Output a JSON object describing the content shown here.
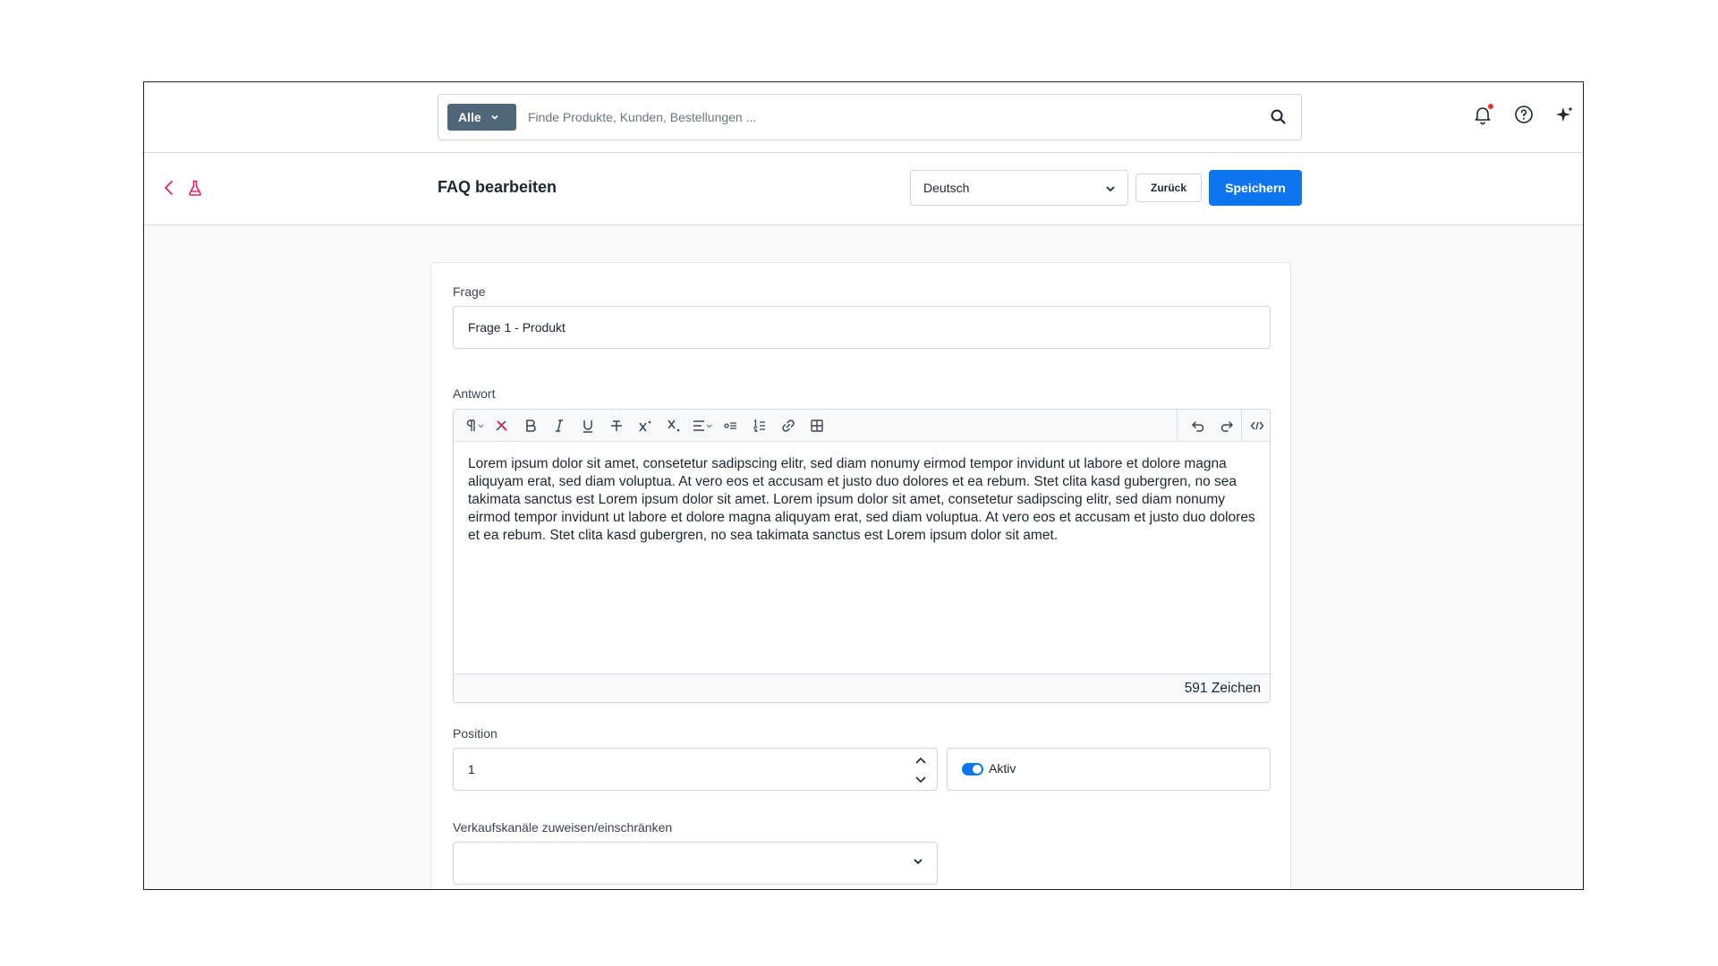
{
  "search": {
    "filter_label": "Alle",
    "placeholder": "Finde Produkte, Kunden, Bestellungen ..."
  },
  "header": {
    "title": "FAQ bearbeiten",
    "language": "Deutsch",
    "back_label": "Zurück",
    "save_label": "Speichern"
  },
  "form": {
    "question_label": "Frage",
    "question_value": "Frage 1 - Produkt",
    "answer_label": "Antwort",
    "answer_text": "Lorem ipsum dolor sit amet, consetetur sadipscing elitr, sed diam nonumy eirmod tempor invidunt ut labore et dolore magna aliquyam erat, sed diam voluptua. At vero eos et accusam et justo duo dolores et ea rebum. Stet clita kasd gubergren, no sea takimata sanctus est Lorem ipsum dolor sit amet. Lorem ipsum dolor sit amet, consetetur sadipscing elitr, sed diam nonumy eirmod tempor invidunt ut labore et dolore magna aliquyam erat, sed diam voluptua. At vero eos et accusam et justo duo dolores et ea rebum. Stet clita kasd gubergren, no sea takimata sanctus est Lorem ipsum dolor sit amet.",
    "char_count": "591 Zeichen",
    "position_label": "Position",
    "position_value": "1",
    "active_label": "Aktiv",
    "active": true,
    "channels_label": "Verkaufskanäle zuweisen/einschränken",
    "channels_value": ""
  },
  "toolbar": {
    "buttons": [
      "paragraph-icon",
      "clear-format-icon",
      "bold-icon",
      "italic-icon",
      "underline-icon",
      "strikethrough-icon",
      "superscript-icon",
      "subscript-icon",
      "align-icon",
      "bullet-list-icon",
      "numbered-list-icon",
      "link-icon",
      "table-icon",
      "undo-icon",
      "redo-icon",
      "code-view-icon"
    ]
  },
  "colors": {
    "accent": "#0f75ef",
    "filter_bg": "#52667a",
    "brand_pink": "#e5245f",
    "notification_dot": "#e5332a"
  }
}
